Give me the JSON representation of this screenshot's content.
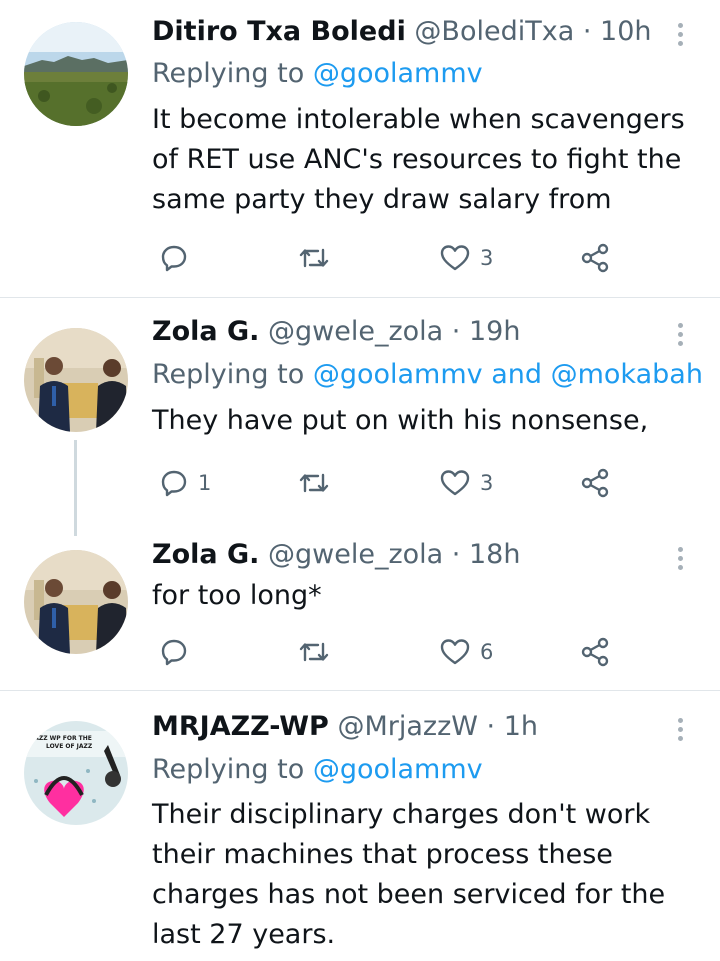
{
  "colors": {
    "link": "#1d9bf0",
    "muted": "#536471",
    "text": "#0f1419",
    "divider": "#e1e6ea"
  },
  "tweets": [
    {
      "name": "Ditiro Txa Boledi",
      "handle": "@BolediTxa",
      "sep": "·",
      "time": "10h",
      "replying_label": "Replying to",
      "replying_to": [
        "@goolammv"
      ],
      "text": "It become intolerable when scavengers of RET use ANC's resources to fight the same party they draw salary from",
      "counts": {
        "reply": "",
        "retweet": "",
        "like": "3"
      },
      "avatar": "landscape-photo"
    },
    {
      "name": "Zola G.",
      "handle": "@gwele_zola",
      "sep": "·",
      "time": "19h",
      "replying_label": "Replying to",
      "replying_to": [
        "@goolammv",
        "@mokabah"
      ],
      "replying_joiner": "and",
      "text": "They have put on with his nonsense,",
      "counts": {
        "reply": "1",
        "retweet": "",
        "like": "3"
      },
      "avatar": "two-men-photo"
    },
    {
      "name": "Zola G.",
      "handle": "@gwele_zola",
      "sep": "·",
      "time": "18h",
      "text": "for too long*",
      "counts": {
        "reply": "",
        "retweet": "",
        "like": "6"
      },
      "avatar": "two-men-photo"
    },
    {
      "name": "MRJAZZ-WP",
      "handle": "@MrjazzW",
      "sep": "·",
      "time": "1h",
      "replying_label": "Replying to",
      "replying_to": [
        "@goolammv"
      ],
      "text": "Their disciplinary charges don't work their machines that process these charges has not been serviced for the last 27 years.",
      "counts": {
        "reply": "",
        "retweet": "",
        "like": ""
      },
      "avatar": "jazz-logo",
      "avatar_text": [
        "JAZZ WP FOR THE",
        "LOVE OF JAZZ"
      ]
    }
  ],
  "icons": {
    "reply": "reply-icon",
    "retweet": "retweet-icon",
    "like": "heart-icon",
    "share": "share-icon",
    "more": "more-vertical-icon"
  }
}
